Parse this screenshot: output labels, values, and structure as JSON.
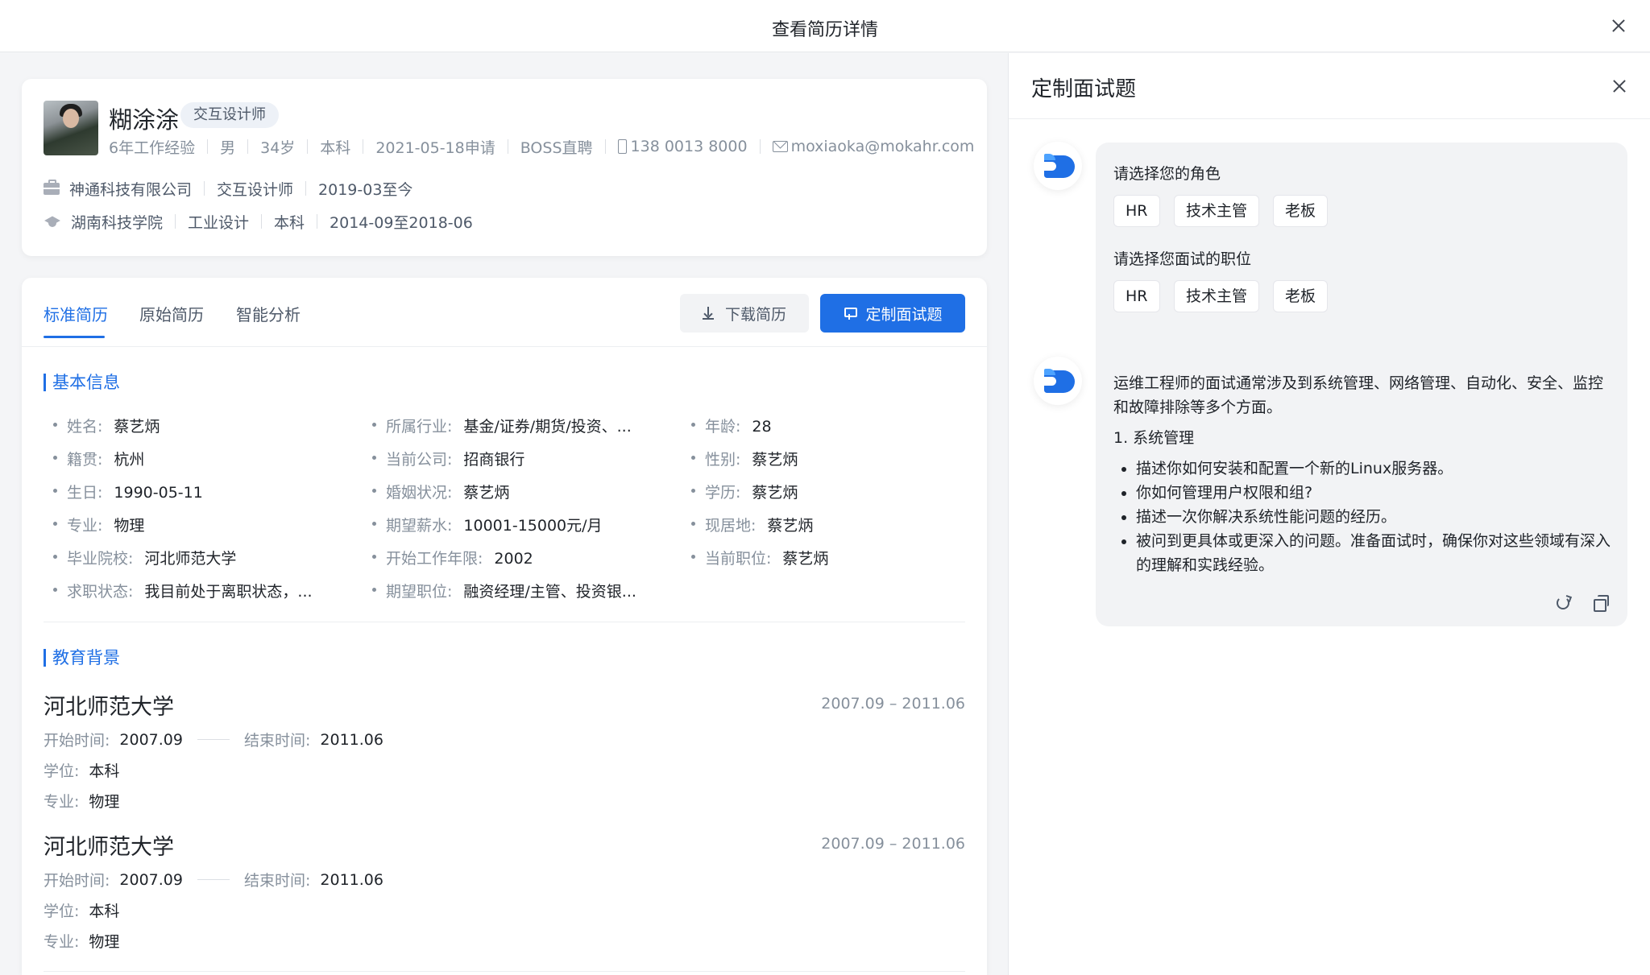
{
  "modal": {
    "title": "查看简历详情"
  },
  "profile": {
    "name": "糊涂涂",
    "role_tag": "交互设计师",
    "meta": {
      "experience": "6年工作经验",
      "gender": "男",
      "age": "34岁",
      "degree": "本科",
      "applied": "2021-05-18申请",
      "source": "BOSS直聘",
      "phone": "138 0013 8000",
      "email": "moxiaoka@mokahr.com"
    },
    "work": {
      "company": "神通科技有限公司",
      "title": "交互设计师",
      "period": "2019-03至今"
    },
    "edu": {
      "school": "湖南科技学院",
      "major": "工业设计",
      "degree": "本科",
      "period": "2014-09至2018-06"
    }
  },
  "tabs": [
    "标准简历",
    "原始简历",
    "智能分析"
  ],
  "actions": {
    "download": "下载简历",
    "custom": "定制面试题"
  },
  "basic": {
    "title": "基本信息",
    "col1": [
      {
        "k": "姓名:",
        "v": "蔡艺炳"
      },
      {
        "k": "籍贯:",
        "v": "杭州"
      },
      {
        "k": "生日:",
        "v": "1990-05-11"
      },
      {
        "k": "专业:",
        "v": "物理"
      },
      {
        "k": "毕业院校:",
        "v": "河北师范大学"
      },
      {
        "k": "求职状态:",
        "v": "我目前处于离职状态，..."
      }
    ],
    "col2": [
      {
        "k": "所属行业:",
        "v": "基金/证券/期货/投资、..."
      },
      {
        "k": "当前公司:",
        "v": "招商银行"
      },
      {
        "k": "婚姻状况:",
        "v": "蔡艺炳"
      },
      {
        "k": "期望薪水:",
        "v": "10001-15000元/月"
      },
      {
        "k": "开始工作年限:",
        "v": "2002"
      },
      {
        "k": "期望职位:",
        "v": "融资经理/主管、投资银..."
      }
    ],
    "col3": [
      {
        "k": "年龄:",
        "v": "28"
      },
      {
        "k": "性别:",
        "v": "蔡艺炳"
      },
      {
        "k": "学历:",
        "v": "蔡艺炳"
      },
      {
        "k": "现居地:",
        "v": "蔡艺炳"
      },
      {
        "k": "当前职位:",
        "v": "蔡艺炳"
      }
    ]
  },
  "education": {
    "title": "教育背景",
    "items": [
      {
        "school": "河北师范大学",
        "period": "2007.09 – 2011.06",
        "start_k": "开始时间:",
        "start_v": "2007.09",
        "end_k": "结束时间:",
        "end_v": "2011.06",
        "degree_k": "学位:",
        "degree_v": "本科",
        "major_k": "专业:",
        "major_v": "物理"
      },
      {
        "school": "河北师范大学",
        "period": "2007.09 – 2011.06",
        "start_k": "开始时间:",
        "start_v": "2007.09",
        "end_k": "结束时间:",
        "end_v": "2011.06",
        "degree_k": "学位:",
        "degree_v": "本科",
        "major_k": "专业:",
        "major_v": "物理"
      }
    ]
  },
  "panel": {
    "title": "定制面试题",
    "q_role": "请选择您的角色",
    "q_position": "请选择您面试的职位",
    "role_chips": [
      "HR",
      "技术主管",
      "老板"
    ],
    "position_chips": [
      "HR",
      "技术主管",
      "老板"
    ],
    "answer_intro": "运维工程师的面试通常涉及到系统管理、网络管理、自动化、安全、监控和故障排除等多个方面。",
    "answer_heading": "1. 系统管理",
    "answer_points": [
      "描述你如何安装和配置一个新的Linux服务器。",
      "你如何管理用户权限和组?",
      "描述一次你解决系统性能问题的经历。",
      "被问到更具体或更深入的问题。准备面试时，确保你对这些领域有深入的理解和实践经验。"
    ]
  },
  "colors": {
    "accent": "#1f6fe5",
    "page_bg": "#f4f5f7"
  }
}
